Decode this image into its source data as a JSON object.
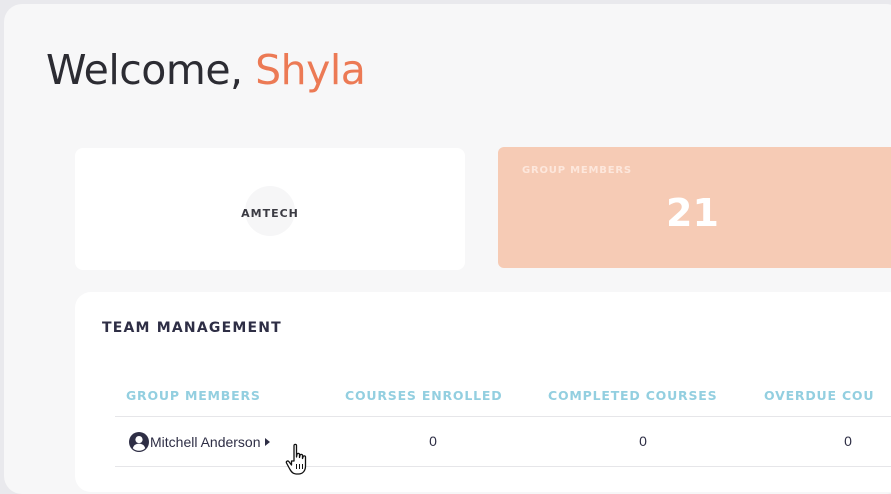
{
  "welcome": {
    "prefix": "Welcome, ",
    "name": "Shyla"
  },
  "org": {
    "name": "AMTECH"
  },
  "stats": {
    "group_members_label": "GROUP MEMBERS",
    "group_members_value": "21"
  },
  "colors": {
    "accent_name": "#ec7a55",
    "stat_card_bg": "#f6cbb5",
    "header_text": "#93cfe0"
  },
  "team": {
    "title": "TEAM MANAGEMENT",
    "columns": [
      "GROUP MEMBERS",
      "COURSES ENROLLED",
      "COMPLETED COURSES",
      "OVERDUE COU"
    ],
    "rows": [
      {
        "name": "Mitchell Anderson",
        "icon": "user-circle-icon",
        "enrolled": "0",
        "completed": "0",
        "overdue": "0"
      }
    ]
  }
}
